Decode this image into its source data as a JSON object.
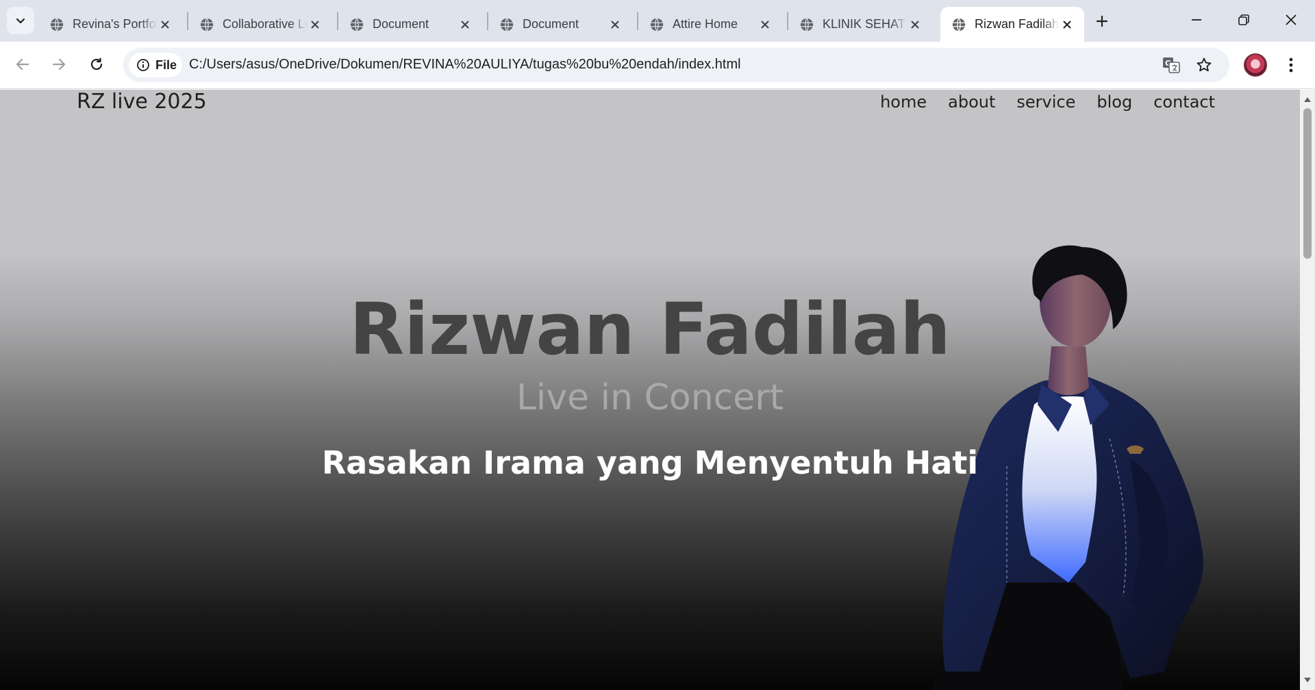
{
  "browser": {
    "tabs": [
      {
        "title": "Revina's Portfolio",
        "active": false
      },
      {
        "title": "Collaborative Learning",
        "active": false
      },
      {
        "title": "Document",
        "active": false
      },
      {
        "title": "Document",
        "active": false
      },
      {
        "title": "Attire Home",
        "active": false
      },
      {
        "title": "KLINIK SEHAT",
        "active": false
      },
      {
        "title": "Rizwan Fadilah",
        "active": true
      }
    ],
    "address_chip": "File",
    "url": "C:/Users/asus/OneDrive/Dokumen/REVINA%20AULIYA/tugas%20bu%20endah/index.html",
    "icons": {
      "tab_search": "chevron-down-icon",
      "tab_favicon": "globe-icon",
      "tab_close": "close-icon",
      "new_tab": "plus-icon",
      "back": "back-arrow-icon",
      "forward": "forward-arrow-icon",
      "reload": "reload-icon",
      "site_info": "info-icon",
      "translate": "translate-icon",
      "bookmark": "star-icon",
      "profile": "avatar",
      "menu": "kebab-menu-icon",
      "minimize": "minimize-icon",
      "restore": "restore-icon",
      "close_window": "close-icon"
    }
  },
  "page": {
    "brand": "RZ live 2025",
    "nav": [
      "home",
      "about",
      "service",
      "blog",
      "contact"
    ],
    "hero": {
      "name": "Rizwan Fadilah",
      "subtitle": "Live in Concert",
      "tagline": "Rasakan Irama yang Menyentuh Hati"
    }
  },
  "colors": {
    "tabstrip_bg": "#dfe3eb",
    "omnibox_bg": "#eef1f6",
    "hero_top": "#c4c3c5",
    "hero_bottom": "#050505",
    "hero_name": "#444444",
    "hero_subtitle": "#a9a9a9",
    "hero_tagline": "#ffffff"
  }
}
